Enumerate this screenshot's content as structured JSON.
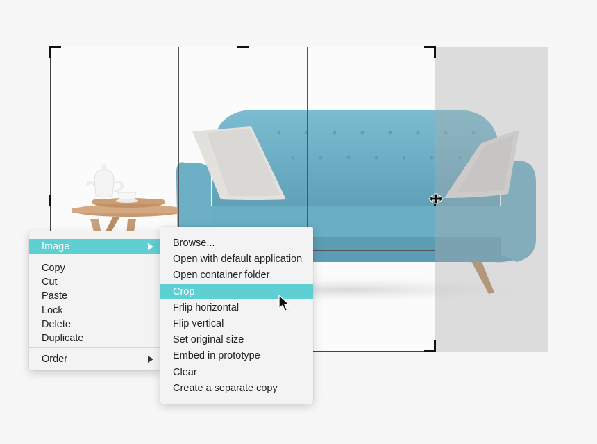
{
  "context_menu": {
    "items": [
      {
        "label": "Image",
        "has_submenu": true,
        "highlighted": true
      },
      {
        "label": "Copy"
      },
      {
        "label": "Cut"
      },
      {
        "label": "Paste"
      },
      {
        "label": "Lock"
      },
      {
        "label": "Delete"
      },
      {
        "label": "Duplicate"
      },
      {
        "label": "Order",
        "has_submenu": true
      }
    ]
  },
  "image_submenu": {
    "items": [
      {
        "label": "Browse..."
      },
      {
        "label": "Open with default application"
      },
      {
        "label": "Open container folder"
      },
      {
        "label": "Crop",
        "highlighted": true
      },
      {
        "label": "Frlip horizontal"
      },
      {
        "label": "Flip vertical"
      },
      {
        "label": "Set original size"
      },
      {
        "label": "Embed in prototype"
      },
      {
        "label": "Clear"
      },
      {
        "label": "Create a separate copy"
      }
    ]
  },
  "colors": {
    "menu_highlight": "#5ecfd2",
    "sofa": "#6fb2c9",
    "crop_shade": "#b9b9b9"
  },
  "icons": [
    "submenu-arrow-icon",
    "resize-horizontal-icon",
    "mouse-pointer-icon"
  ]
}
